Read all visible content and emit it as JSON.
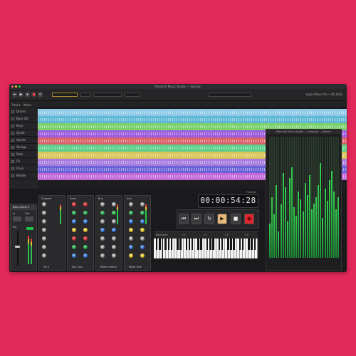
{
  "window": {
    "title": "Pianoroll Music Studio — Session",
    "controls": {
      "close": "#ff5f57",
      "minimize": "#febc2e",
      "maximize": "#28c840"
    }
  },
  "toolbar": {
    "buttons": [
      "⏮",
      "▶",
      "⏹",
      "●",
      "⟲"
    ],
    "right_text": "Logic Mixer Pro • 44.1kHz"
  },
  "ruler": {
    "labels": [
      "Tracks",
      "Mode"
    ]
  },
  "tracks": [
    {
      "name": "Drums",
      "color": "#8ec9e6"
    },
    {
      "name": "Bass Gtr",
      "color": "#5fb8d8"
    },
    {
      "name": "Keys",
      "color": "#7bd06a"
    },
    {
      "name": "Synth",
      "color": "#9c5ee0"
    },
    {
      "name": "Vocals",
      "color": "#d9626a"
    },
    {
      "name": "Strings",
      "color": "#5ccf8a"
    },
    {
      "name": "Pads",
      "color": "#d9c55a"
    },
    {
      "name": "FX",
      "color": "#a77de0"
    },
    {
      "name": "Choir",
      "color": "#6b62d8"
    },
    {
      "name": "Master",
      "color": "#c36ad9"
    }
  ],
  "channel_strip": {
    "title": "Bass Guitar 1",
    "labels": [
      "In",
      "Out",
      "EQ"
    ]
  },
  "modules": [
    {
      "label": "EQ 1",
      "sub": "Channel"
    },
    {
      "label": "Vol / Aux",
      "sub": "Send"
    },
    {
      "label": "Mixer control",
      "sub": "Bus"
    },
    {
      "label": "Mixer Unit",
      "sub": "Aux"
    }
  ],
  "transport": {
    "time": "00:00:54:28",
    "time_label": "Position",
    "buttons": [
      "⏮",
      "⏭",
      "↻",
      "▶",
      "■",
      "●"
    ]
  },
  "keyboard": {
    "label": "Keyboard",
    "octave_labels": [
      "C2",
      "C3",
      "C4",
      "C5"
    ]
  },
  "analyzer": {
    "title": "Pianoroll Music Studio — Analyzer — Master",
    "levels": [
      0.28,
      0.5,
      0.36,
      0.6,
      0.22,
      0.44,
      0.7,
      0.58,
      0.3,
      0.66,
      0.75,
      0.42,
      0.35,
      0.55,
      0.48,
      0.38,
      0.62,
      0.52,
      0.68,
      0.4,
      0.45,
      0.5,
      0.6,
      0.78,
      0.33,
      0.57,
      0.47,
      0.64,
      0.72,
      0.55,
      0.4,
      0.5
    ]
  }
}
